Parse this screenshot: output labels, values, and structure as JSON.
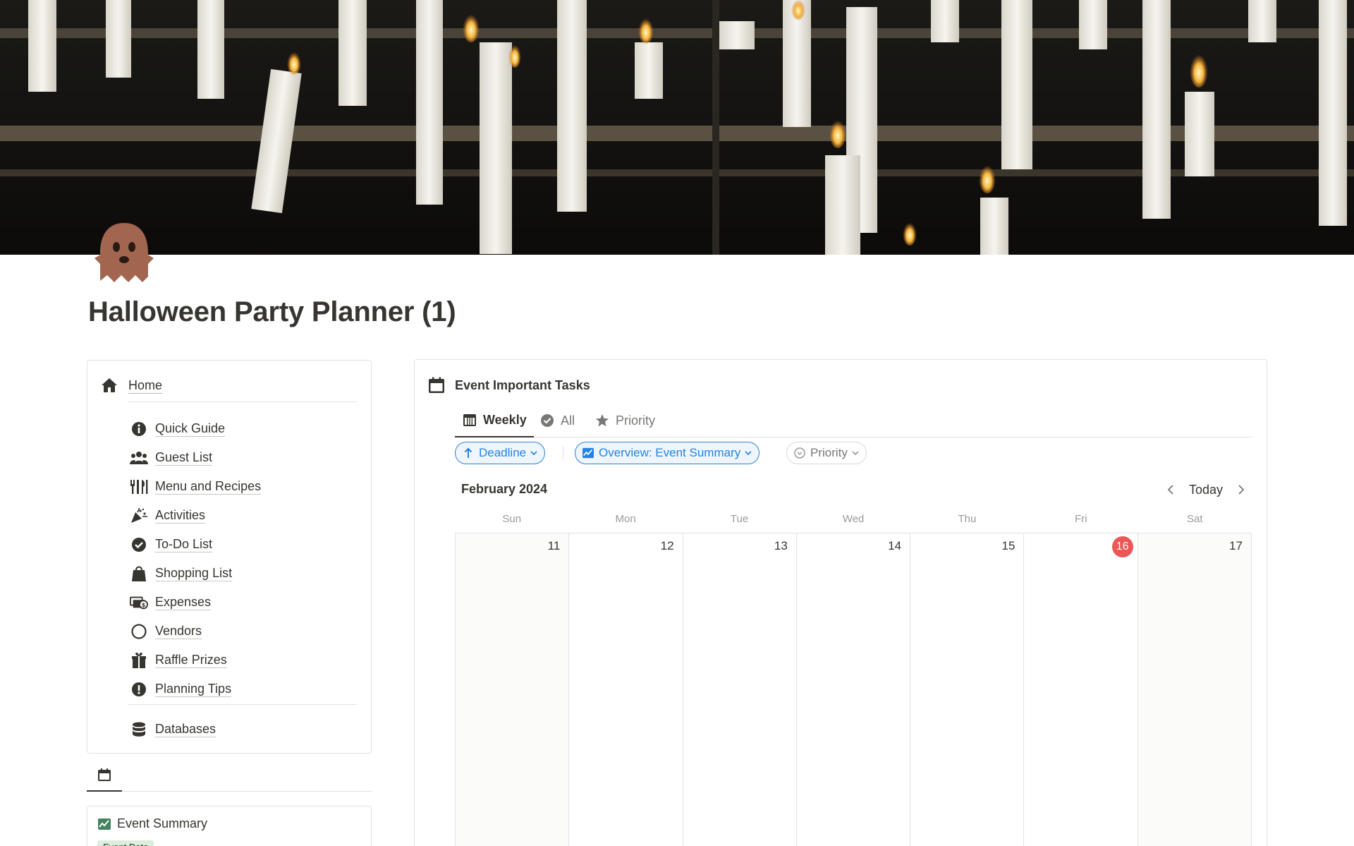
{
  "page": {
    "title": "Halloween Party Planner (1)",
    "cover": "candles-photo",
    "icon": "ghost-icon"
  },
  "nav": {
    "home": {
      "label": "Home",
      "icon": "house-icon"
    },
    "items": [
      {
        "label": "Quick Guide",
        "icon": "info-icon"
      },
      {
        "label": "Guest List",
        "icon": "people-icon"
      },
      {
        "label": "Menu and Recipes",
        "icon": "utensils-icon"
      },
      {
        "label": "Activities",
        "icon": "party-popper-icon"
      },
      {
        "label": "To-Do List",
        "icon": "check-circle-icon"
      },
      {
        "label": "Shopping List",
        "icon": "shopping-bag-icon"
      },
      {
        "label": "Expenses",
        "icon": "money-icon"
      },
      {
        "label": "Vendors",
        "icon": "circle-icon"
      },
      {
        "label": "Raffle Prizes",
        "icon": "gift-icon"
      },
      {
        "label": "Planning Tips",
        "icon": "exclamation-icon"
      }
    ],
    "databases": {
      "label": "Databases",
      "icon": "database-icon"
    }
  },
  "summary": {
    "title": "Event Summary",
    "tag": "Event Date"
  },
  "calendar": {
    "title": "Event Important Tasks",
    "tabs": [
      {
        "label": "Weekly",
        "icon": "calendar-grid-icon",
        "active": true
      },
      {
        "label": "All",
        "icon": "check-circle-icon",
        "active": false
      },
      {
        "label": "Priority",
        "icon": "star-icon",
        "active": false
      }
    ],
    "filters": {
      "sort": "Deadline",
      "overview": "Overview: Event Summary",
      "priority": "Priority"
    },
    "month": "February 2024",
    "today_label": "Today",
    "weekdays": [
      "Sun",
      "Mon",
      "Tue",
      "Wed",
      "Thu",
      "Fri",
      "Sat"
    ],
    "days": [
      "11",
      "12",
      "13",
      "14",
      "15",
      "16",
      "17"
    ],
    "today_index": 5,
    "colors": {
      "today": "#eb5757",
      "accent": "#2383e2"
    }
  }
}
